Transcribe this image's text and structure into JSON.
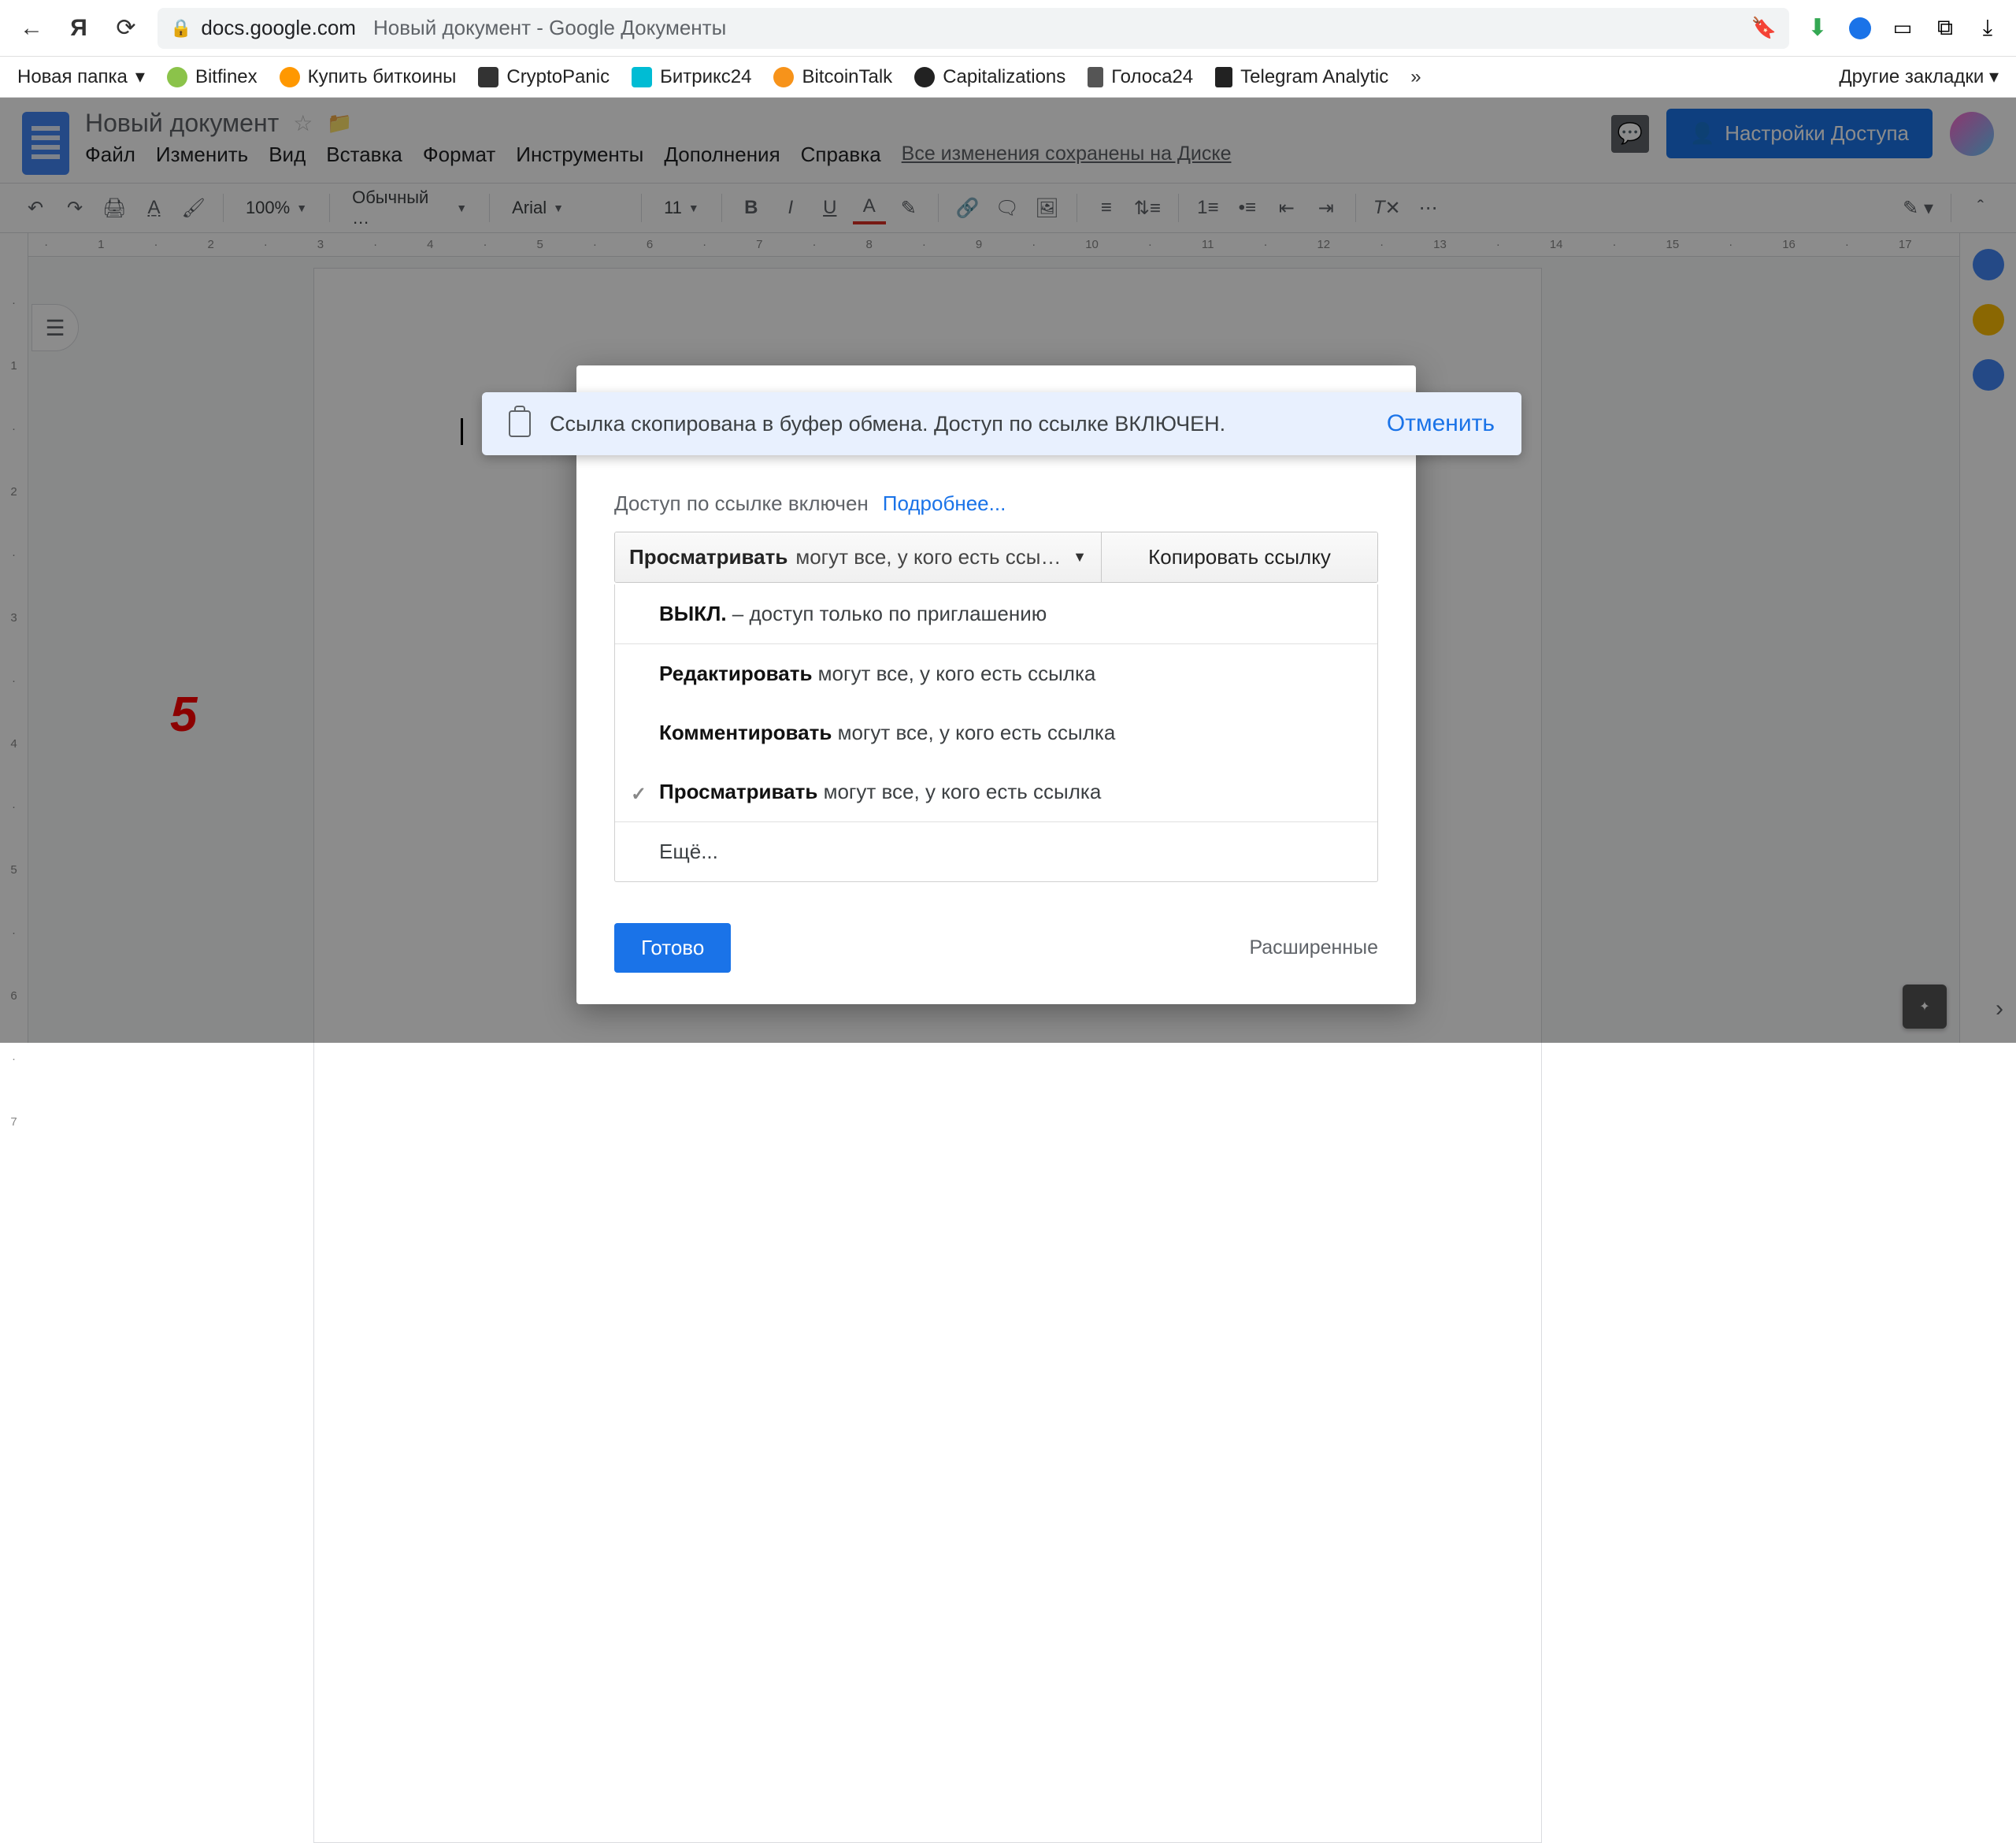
{
  "browser": {
    "host": "docs.google.com",
    "page_title": "Новый документ - Google Документы"
  },
  "bookmarks": {
    "items": [
      {
        "label": "Новая папка",
        "caret": "▾"
      },
      {
        "label": "Bitfinex"
      },
      {
        "label": "Купить биткоины"
      },
      {
        "label": "CryptoPanic"
      },
      {
        "label": "Битрикс24"
      },
      {
        "label": "BitcoinTalk"
      },
      {
        "label": "Capitalizations"
      },
      {
        "label": "Голоса24"
      },
      {
        "label": "Telegram Analytic"
      }
    ],
    "overflow": "»",
    "right": "Другие закладки ▾"
  },
  "docs_header": {
    "title": "Новый документ",
    "menu": [
      "Файл",
      "Изменить",
      "Вид",
      "Вставка",
      "Формат",
      "Инструменты",
      "Дополнения",
      "Справка"
    ],
    "saved": "Все изменения сохранены на Диске",
    "share": "Настройки Доступа"
  },
  "toolbar": {
    "zoom": "100%",
    "style": "Обычный …",
    "font": "Arial",
    "size": "11"
  },
  "annotation": {
    "five": "5"
  },
  "toast": {
    "text": "Ссылка скопирована в буфер обмена. Доступ по ссылке ВКЛЮЧЕН.",
    "cancel": "Отменить"
  },
  "modal": {
    "link_sharing_label": "Доступ по ссылке включен",
    "learn_more": "Подробнее...",
    "perm_strong": "Просматривать",
    "perm_rest": "могут все, у кого есть ссы…",
    "copy_link": "Копировать ссылку",
    "options": [
      {
        "strong": "ВЫКЛ.",
        "rest": " – доступ только по приглашению",
        "checked": false,
        "sep": false
      },
      {
        "strong": "Редактировать",
        "rest": " могут все, у кого есть ссылка",
        "checked": false,
        "sep": true
      },
      {
        "strong": "Комментировать",
        "rest": " могут все, у кого есть ссылка",
        "checked": false,
        "sep": false
      },
      {
        "strong": "Просматривать",
        "rest": " могут все, у кого есть ссылка",
        "checked": true,
        "sep": false
      },
      {
        "strong": "",
        "rest": "Ещё...",
        "checked": false,
        "sep": true
      }
    ],
    "done": "Готово",
    "advanced": "Расширенные"
  }
}
